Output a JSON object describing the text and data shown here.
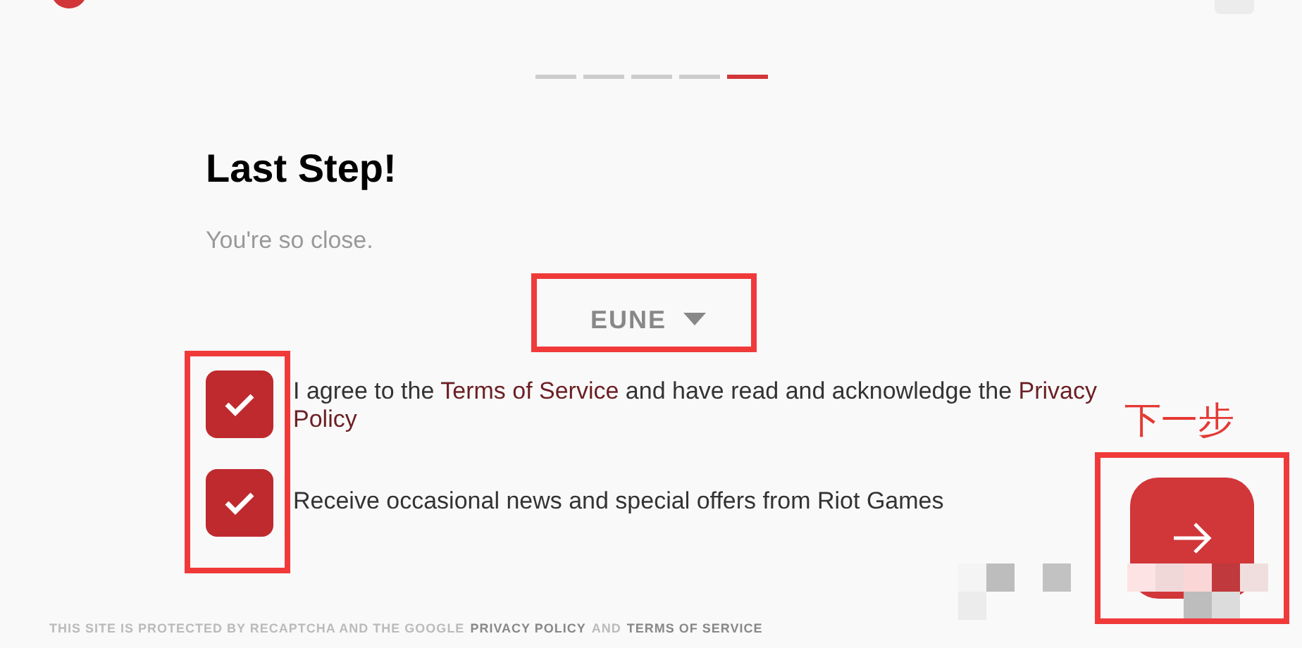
{
  "steps": [
    {
      "selected": false
    },
    {
      "selected": false
    },
    {
      "selected": false
    },
    {
      "selected": false
    },
    {
      "selected": true
    }
  ],
  "heading": "Last Step!",
  "subtitle": "You're so close.",
  "region": {
    "value": "EUNE"
  },
  "checkboxes": [
    {
      "checked": true,
      "text": "I agree to the **Terms of Service** and have read and acknowledge the **Privacy Policy**"
    },
    {
      "checked": true,
      "text": "Receive occasional news and special offers from Riot Games"
    }
  ],
  "annotation": {
    "label": "下一步"
  },
  "footer": [
    {
      "text": "THIS SITE IS PROTECTED BY RECAPTCHA AND THE GOOGLE",
      "link": false
    },
    {
      "text": "PRIVACY POLICY",
      "link": true
    },
    {
      "text": "AND",
      "link": false
    },
    {
      "text": "TERMS OF SERVICE",
      "link": true
    }
  ]
}
